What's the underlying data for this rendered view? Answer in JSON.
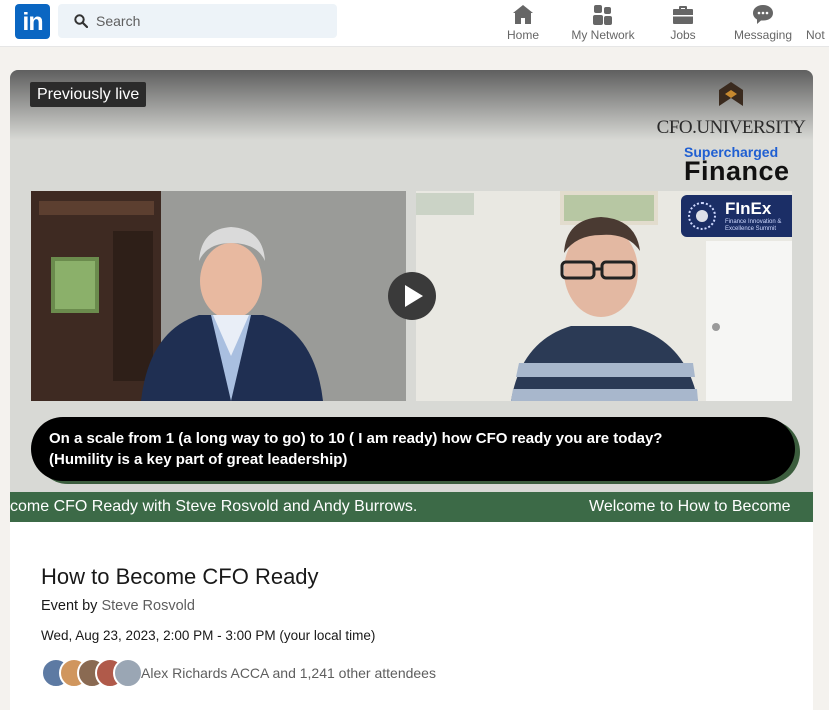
{
  "nav": {
    "logo_text": "in",
    "search_placeholder": "Search",
    "items": [
      {
        "label": "Home",
        "icon": "home-icon"
      },
      {
        "label": "My Network",
        "icon": "network-icon"
      },
      {
        "label": "Jobs",
        "icon": "briefcase-icon"
      },
      {
        "label": "Messaging",
        "icon": "messaging-icon"
      },
      {
        "label": "Not",
        "icon": "bell-icon"
      }
    ]
  },
  "video": {
    "badge": "Previously live",
    "sponsor_logo": "CFO.UNIVERSITY",
    "brand_line1": "Supercharged",
    "brand_line2": "Finance",
    "finex_name": "FInEx",
    "finex_sub": "Finance Innovation & Excellence Summit",
    "question_line1": "On a scale from 1 (a long way to go) to 10 ( I am ready) how CFO ready you are today?",
    "question_line2": "(Humility is a key part of great leadership)",
    "ticker_left": "come CFO Ready with Steve Rosvold and Andy Burrows.",
    "ticker_right": "Welcome to How to Become"
  },
  "event": {
    "title": "How to Become CFO Ready",
    "by_prefix": "Event by",
    "organizer": "Steve Rosvold",
    "datetime": "Wed, Aug 23, 2023, 2:00 PM - 3:00 PM (your local time)",
    "attendees_text": "Alex Richards ACCA and 1,241 other attendees"
  },
  "colors": {
    "brand_blue": "#0a66c2",
    "ticker_green": "#3c6a47",
    "finex_navy": "#1b2e66"
  }
}
